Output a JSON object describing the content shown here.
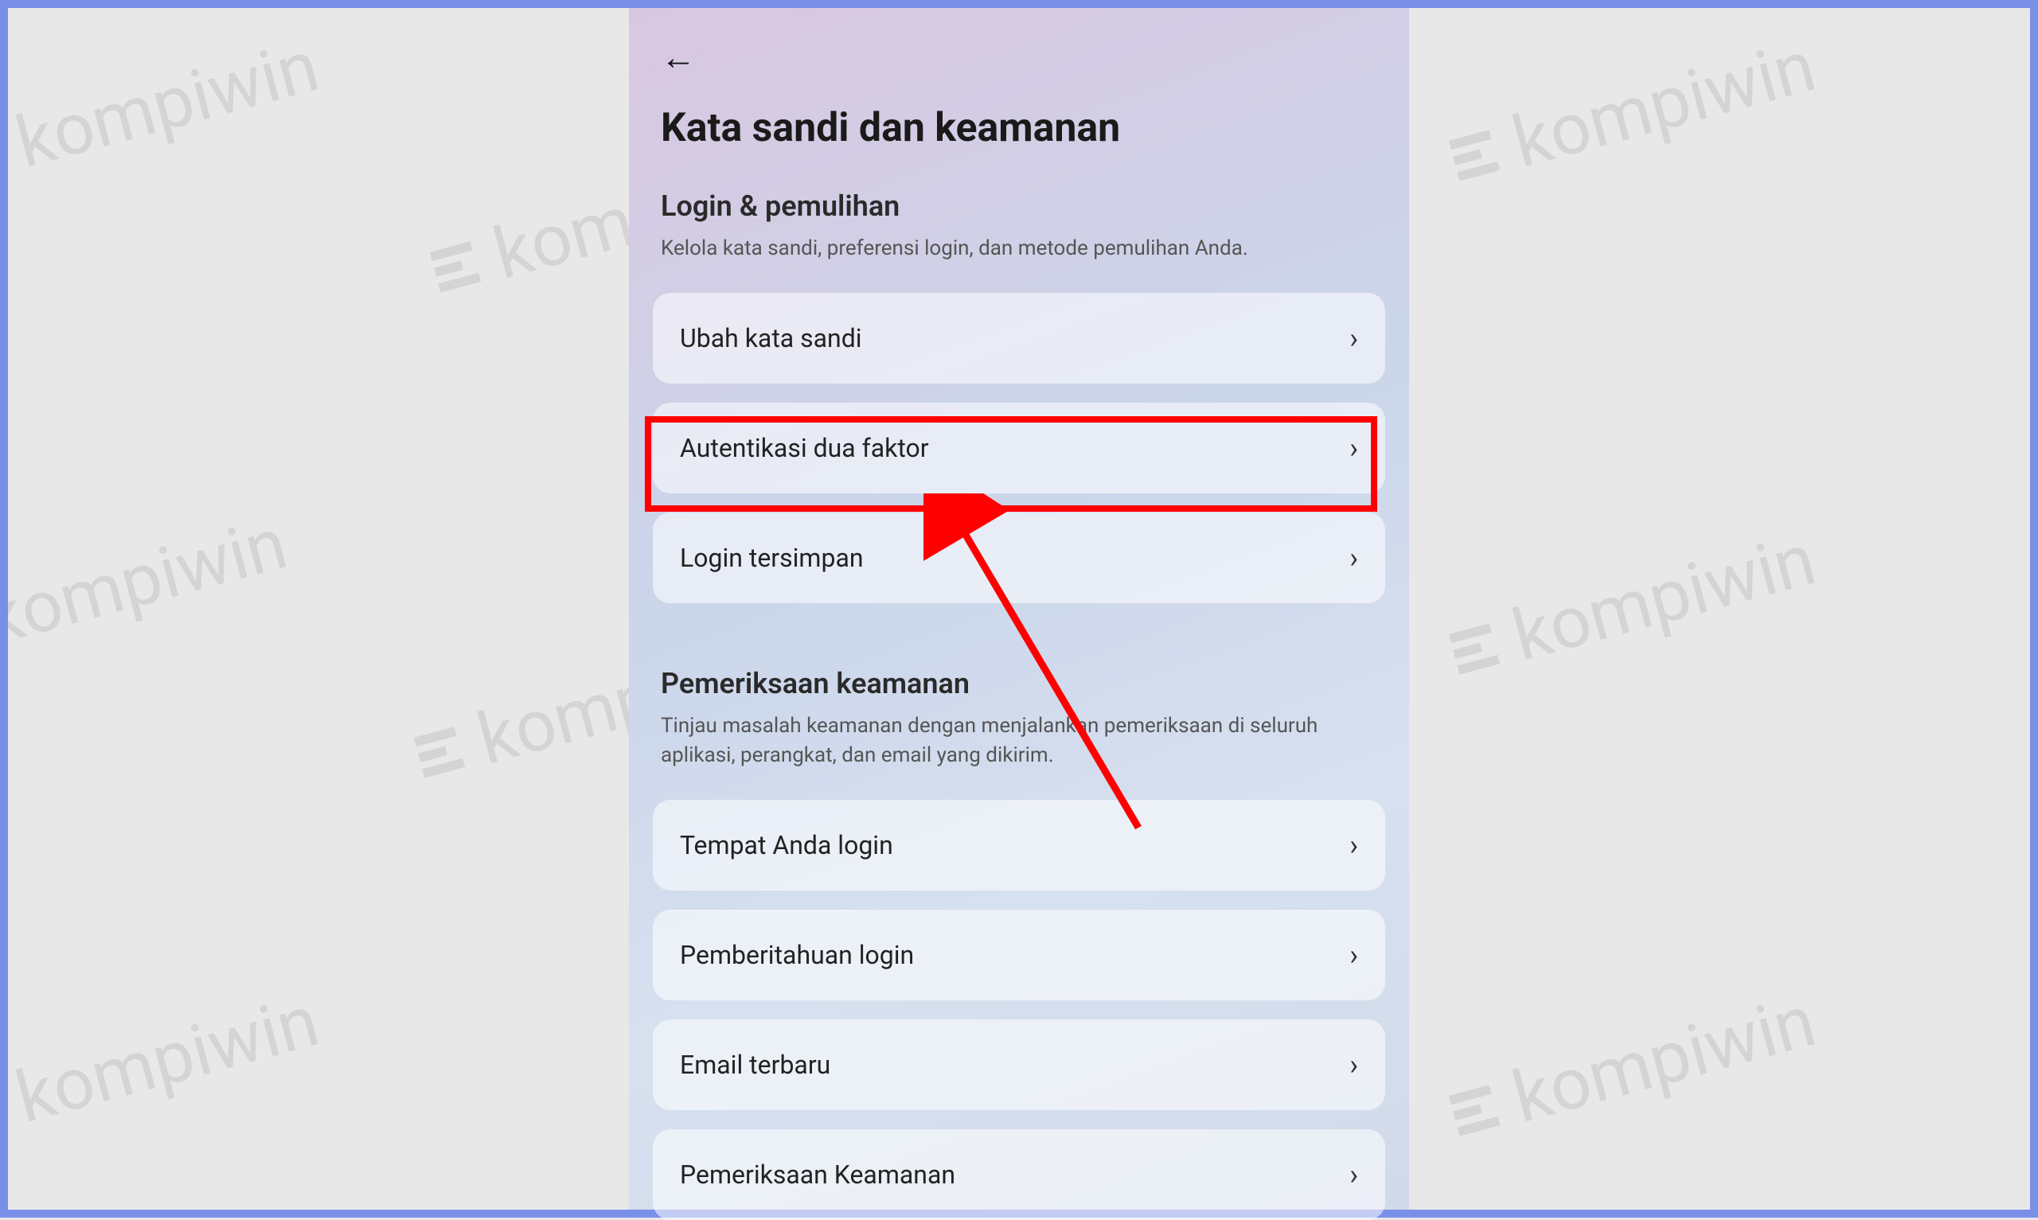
{
  "watermark_text": "kompiwin",
  "header": {
    "page_title": "Kata sandi dan keamanan"
  },
  "sections": {
    "login_recovery": {
      "title": "Login & pemulihan",
      "desc": "Kelola kata sandi, preferensi login, dan metode pemulihan Anda.",
      "items": [
        {
          "label": "Ubah kata sandi"
        },
        {
          "label": "Autentikasi dua faktor"
        },
        {
          "label": "Login tersimpan"
        }
      ]
    },
    "security_check": {
      "title": "Pemeriksaan keamanan",
      "desc": "Tinjau masalah keamanan dengan menjalankan pemeriksaan di seluruh aplikasi, perangkat, dan email yang dikirim.",
      "items": [
        {
          "label": "Tempat Anda login"
        },
        {
          "label": "Pemberitahuan login"
        },
        {
          "label": "Email terbaru"
        },
        {
          "label": "Pemeriksaan Keamanan"
        }
      ]
    }
  }
}
